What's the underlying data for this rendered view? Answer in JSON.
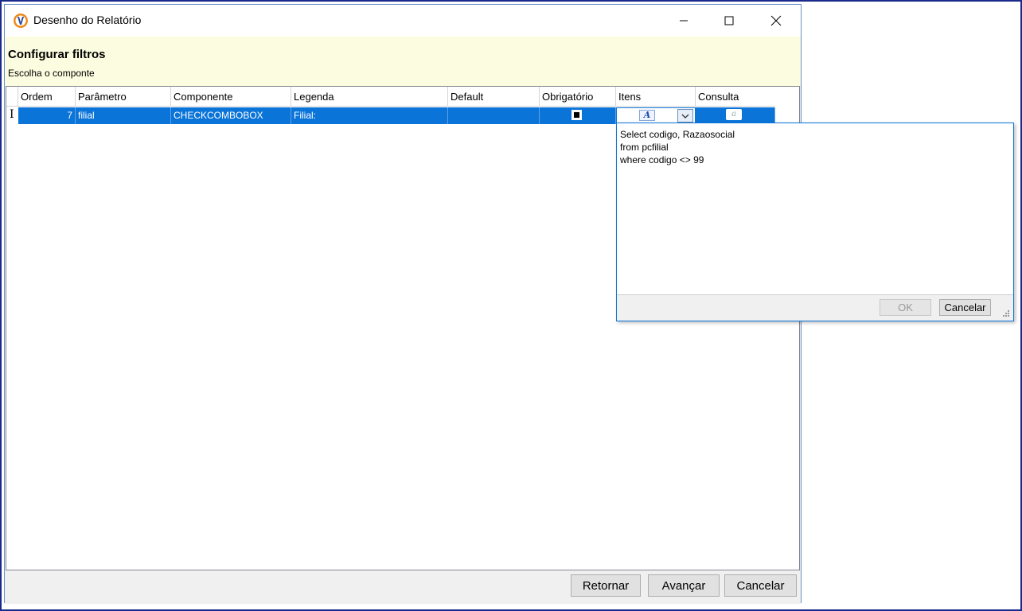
{
  "window": {
    "title": "Desenho do Relatório",
    "minimize_label": "—",
    "maximize_label": "☐",
    "close_label": "✕"
  },
  "header": {
    "title": "Configurar filtros",
    "subtitle": "Escolha o componte"
  },
  "grid": {
    "columns": [
      "Ordem",
      "Parâmetro",
      "Componente",
      "Legenda",
      "Default",
      "Obrigatório",
      "Itens",
      "Consulta"
    ],
    "rows": [
      {
        "indicator": "I",
        "ordem": "7",
        "parametro": "filial",
        "componente": "CHECKCOMBOBOX",
        "legenda": "Filial:",
        "default": "",
        "obrigatorio": true
      }
    ]
  },
  "popup": {
    "text": "Select codigo, Razaosocial\nfrom pcfilial\nwhere codigo <> 99",
    "ok_label": "OK",
    "cancel_label": "Cancelar"
  },
  "footer": {
    "retornar_label": "Retornar",
    "avancar_label": "Avançar",
    "cancelar_label": "Cancelar"
  }
}
